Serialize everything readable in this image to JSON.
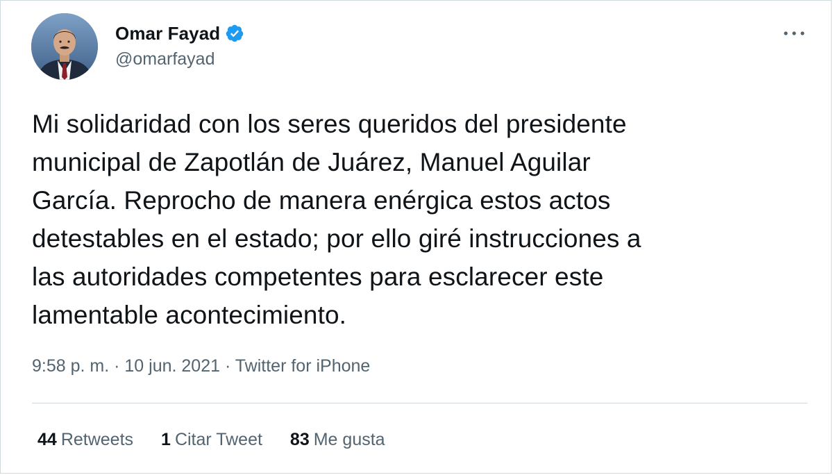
{
  "author": {
    "display_name": "Omar Fayad",
    "handle": "@omarfayad",
    "verified": true,
    "verified_icon": "verified-badge-icon",
    "avatar_icon": "profile-photo"
  },
  "menu": {
    "icon": "more-options-icon"
  },
  "tweet": {
    "text": "Mi solidaridad con los seres queridos del presidente\nmunicipal de Zapotlán de Juárez, Manuel Aguilar\nGarcía. Reprocho de manera enérgica estos actos\ndetestables en el estado; por ello giré instrucciones a\nlas autoridades competentes para esclarecer este\nlamentable acontecimiento."
  },
  "meta": {
    "time": "9:58 p. m.",
    "separator": " · ",
    "date": "10 jun. 2021",
    "source": "Twitter for iPhone"
  },
  "stats": [
    {
      "count": "44",
      "label": "Retweets"
    },
    {
      "count": "1",
      "label": "Citar Tweet"
    },
    {
      "count": "83",
      "label": "Me gusta"
    }
  ],
  "colors": {
    "text": "#0f1419",
    "secondary": "#536471",
    "verified": "#1d9bf0",
    "border": "#cfd9de"
  }
}
